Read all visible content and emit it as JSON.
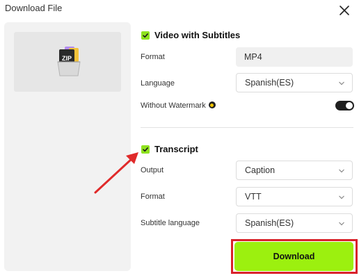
{
  "dialog": {
    "title": "Download File",
    "close_icon": "close-icon"
  },
  "preview": {
    "icon": "zip-file-icon",
    "icon_text": "ZIP"
  },
  "video_section": {
    "title": "Video with Subtitles",
    "checked": true,
    "format_label": "Format",
    "format_value": "MP4",
    "language_label": "Language",
    "language_value": "Spanish(ES)",
    "watermark_label": "Without Watermark",
    "watermark_enabled": true
  },
  "transcript_section": {
    "title": "Transcript",
    "checked": true,
    "output_label": "Output",
    "output_value": "Caption",
    "format_label": "Format",
    "format_value": "VTT",
    "subtitle_language_label": "Subtitle language",
    "subtitle_language_value": "Spanish(ES)"
  },
  "actions": {
    "download_label": "Download"
  },
  "colors": {
    "accent": "#9cf00f",
    "checkbox": "#8fe21f",
    "highlight": "#d9222a",
    "annotation_arrow": "#e02a2a"
  }
}
